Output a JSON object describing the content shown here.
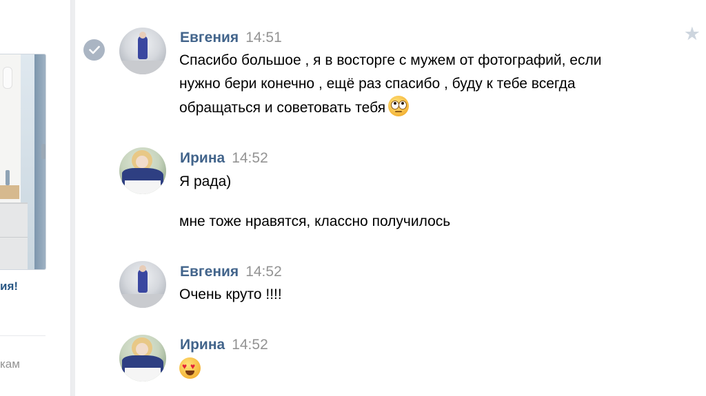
{
  "left_panel": {
    "caption": "ия!",
    "footer": "кам"
  },
  "messages": [
    {
      "author": "Евгения",
      "time": "14:51",
      "lines": [
        "Спасибо большое , я в восторге с мужем от фотографий, если",
        "нужно бери конечно , ещё раз спасибо , буду к тебе всегда",
        "обращаться и советовать тебя"
      ],
      "emoji": "rolling-eyes-emoji"
    },
    {
      "author": "Ирина",
      "time": "14:52",
      "lines": [
        "Я рада)",
        "мне тоже нравятся, классно получилось"
      ]
    },
    {
      "author": "Евгения",
      "time": "14:52",
      "lines": [
        "Очень круто !!!!"
      ]
    },
    {
      "author": "Ирина",
      "time": "14:52",
      "emoji": "heart-eyes-emoji"
    }
  ],
  "colors": {
    "author": "#42648b",
    "time": "#939393",
    "link": "#2a5885",
    "check": "#aab5c3",
    "star": "#cdd5de"
  },
  "icons": [
    "check-icon",
    "star-icon"
  ]
}
